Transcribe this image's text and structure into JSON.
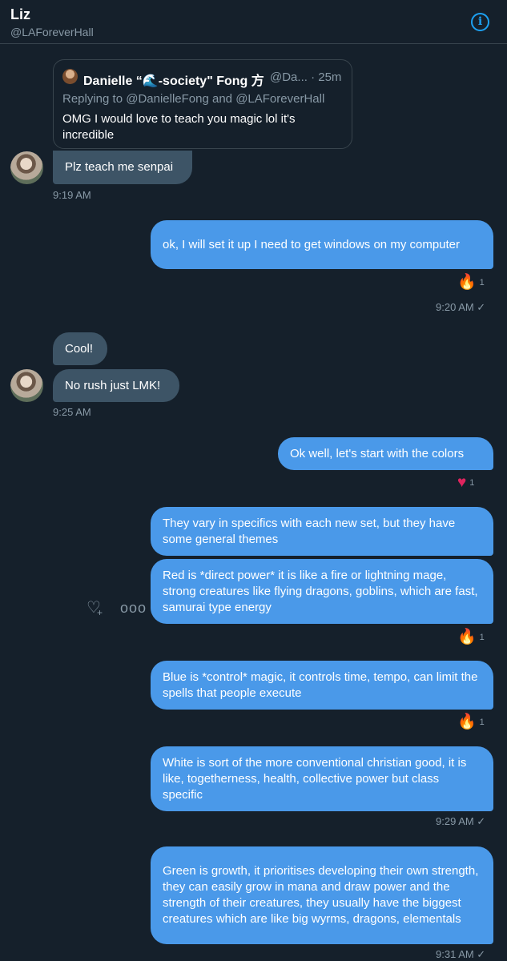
{
  "header": {
    "name": "Liz",
    "handle": "@LAForeverHall",
    "info_icon": "info-icon"
  },
  "quote": {
    "name": "Danielle “🌊-society\" Fong 方",
    "meta": "@Da... · 25m",
    "replying_to": "Replying to @DanielleFong and @LAForeverHall",
    "text": "OMG I would love to teach you magic lol it's incredible"
  },
  "messages": [
    {
      "text": "Plz teach me senpai",
      "time": "9:19 AM"
    },
    {
      "text": "ok, I will set it up I need to get windows on my computer",
      "reaction": "🔥",
      "reaction_count": "1",
      "time": "9:20 AM ✓"
    },
    {
      "text": "Cool!"
    },
    {
      "text": "No rush just LMK!",
      "time": "9:25 AM"
    },
    {
      "text": "Ok well, let's start with the colors",
      "reaction": "❤️",
      "reaction_count": "1"
    },
    {
      "text": "They vary in specifics with each new set, but they have some general themes"
    },
    {
      "text": "Red is *direct power* it is like a fire or lightning mage, strong creatures like flying dragons, goblins, which are fast, samurai type energy",
      "reaction": "🔥",
      "reaction_count": "1"
    },
    {
      "text": "Blue is *control* magic, it controls time, tempo, can limit the spells that people execute",
      "reaction": "🔥",
      "reaction_count": "1"
    },
    {
      "text": "White is sort of the more conventional christian good, it is like, togetherness, health, collective power but class specific",
      "time": "9:29 AM ✓"
    },
    {
      "text": "Green is growth, it prioritises developing their own strength, they can easily grow in mana and draw power and the strength of their creatures, they usually have the biggest creatures which are like big wyrms, dragons, elementals",
      "time": "9:31 AM ✓"
    }
  ],
  "hover_actions": {
    "react_icon": "heart-plus-icon",
    "more_icon": "more-icon",
    "more_glyph": "ooo"
  },
  "colors": {
    "background": "#15202b",
    "incoming_bubble": "#3d5466",
    "outgoing_bubble": "#4a99e9",
    "accent": "#1da1f2",
    "secondary_text": "#8899a6"
  }
}
